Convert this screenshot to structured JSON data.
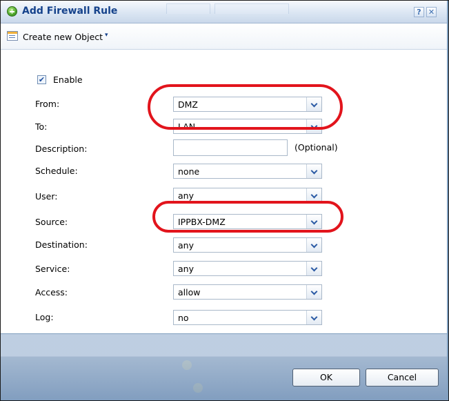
{
  "dialog": {
    "title": "Add Firewall Rule",
    "help_label": "?",
    "close_label": "✕"
  },
  "toolbar": {
    "create_object_label": "Create new Object",
    "caret": "▾"
  },
  "form": {
    "enable": {
      "label": "Enable",
      "checked": true,
      "check_glyph": "✔"
    },
    "from": {
      "label": "From:",
      "value": "DMZ"
    },
    "to": {
      "label": "To:",
      "value": "LAN"
    },
    "description": {
      "label": "Description:",
      "value": "",
      "hint": "(Optional)"
    },
    "schedule": {
      "label": "Schedule:",
      "value": "none"
    },
    "user": {
      "label": "User:",
      "value": "any"
    },
    "source": {
      "label": "Source:",
      "value": "IPPBX-DMZ"
    },
    "destination": {
      "label": "Destination:",
      "value": "any"
    },
    "service": {
      "label": "Service:",
      "value": "any"
    },
    "access": {
      "label": "Access:",
      "value": "allow"
    },
    "log": {
      "label": "Log:",
      "value": "no"
    }
  },
  "buttons": {
    "ok_label": "OK",
    "cancel_label": "Cancel"
  },
  "annotation_color": "#e2141c",
  "icons": {
    "title": "add-circle-icon",
    "toolbar": "object-list-icon"
  }
}
